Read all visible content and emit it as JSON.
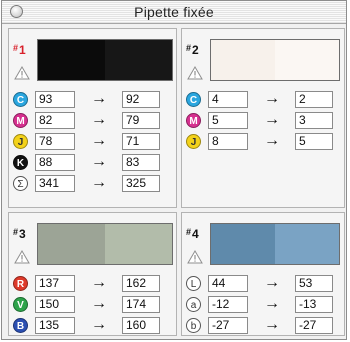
{
  "window": {
    "title": "Pipette fixée"
  },
  "arrow": "→",
  "panels": [
    {
      "number": "1",
      "colors": {
        "left": "#0b0b0b",
        "right": "#171717",
        "number": "#d8202a"
      },
      "rows": [
        {
          "channel": "C",
          "icon": "cyan-channel-icon",
          "color": "#2aa6df",
          "from": "93",
          "to": "92"
        },
        {
          "channel": "M",
          "icon": "magenta-channel-icon",
          "color": "#d6308f",
          "from": "82",
          "to": "79"
        },
        {
          "channel": "J",
          "icon": "yellow-channel-icon",
          "color": "#f3d21a",
          "from": "78",
          "to": "71"
        },
        {
          "channel": "K",
          "icon": "black-channel-icon",
          "color": "#111111",
          "from": "88",
          "to": "83"
        },
        {
          "channel": "Σ",
          "icon": "sum-icon",
          "color": "outline",
          "from": "341",
          "to": "325"
        }
      ]
    },
    {
      "number": "2",
      "colors": {
        "left": "#f7f1eb",
        "right": "#fbf7f3"
      },
      "rows": [
        {
          "channel": "C",
          "icon": "cyan-channel-icon",
          "color": "#2aa6df",
          "from": "4",
          "to": "2"
        },
        {
          "channel": "M",
          "icon": "magenta-channel-icon",
          "color": "#d6308f",
          "from": "5",
          "to": "3"
        },
        {
          "channel": "J",
          "icon": "yellow-channel-icon",
          "color": "#f3d21a",
          "from": "8",
          "to": "5"
        }
      ]
    },
    {
      "number": "3",
      "colors": {
        "left": "#9ca496",
        "right": "#b2bcaa"
      },
      "rows": [
        {
          "channel": "R",
          "icon": "red-channel-icon",
          "color": "#de3a2a",
          "from": "137",
          "to": "162"
        },
        {
          "channel": "V",
          "icon": "green-channel-icon",
          "color": "#2da34a",
          "from": "150",
          "to": "174"
        },
        {
          "channel": "B",
          "icon": "blue-channel-icon",
          "color": "#2b4fb2",
          "from": "135",
          "to": "160"
        }
      ]
    },
    {
      "number": "4",
      "colors": {
        "left": "#5f8aab",
        "right": "#7aa3c4"
      },
      "rows": [
        {
          "channel": "L",
          "icon": "lightness-channel-icon",
          "color": "outline",
          "from": "44",
          "to": "53"
        },
        {
          "channel": "a",
          "icon": "a-channel-icon",
          "color": "outline",
          "from": "-12",
          "to": "-13"
        },
        {
          "channel": "b",
          "icon": "b-channel-icon",
          "color": "outline",
          "from": "-27",
          "to": "-27"
        }
      ]
    }
  ]
}
